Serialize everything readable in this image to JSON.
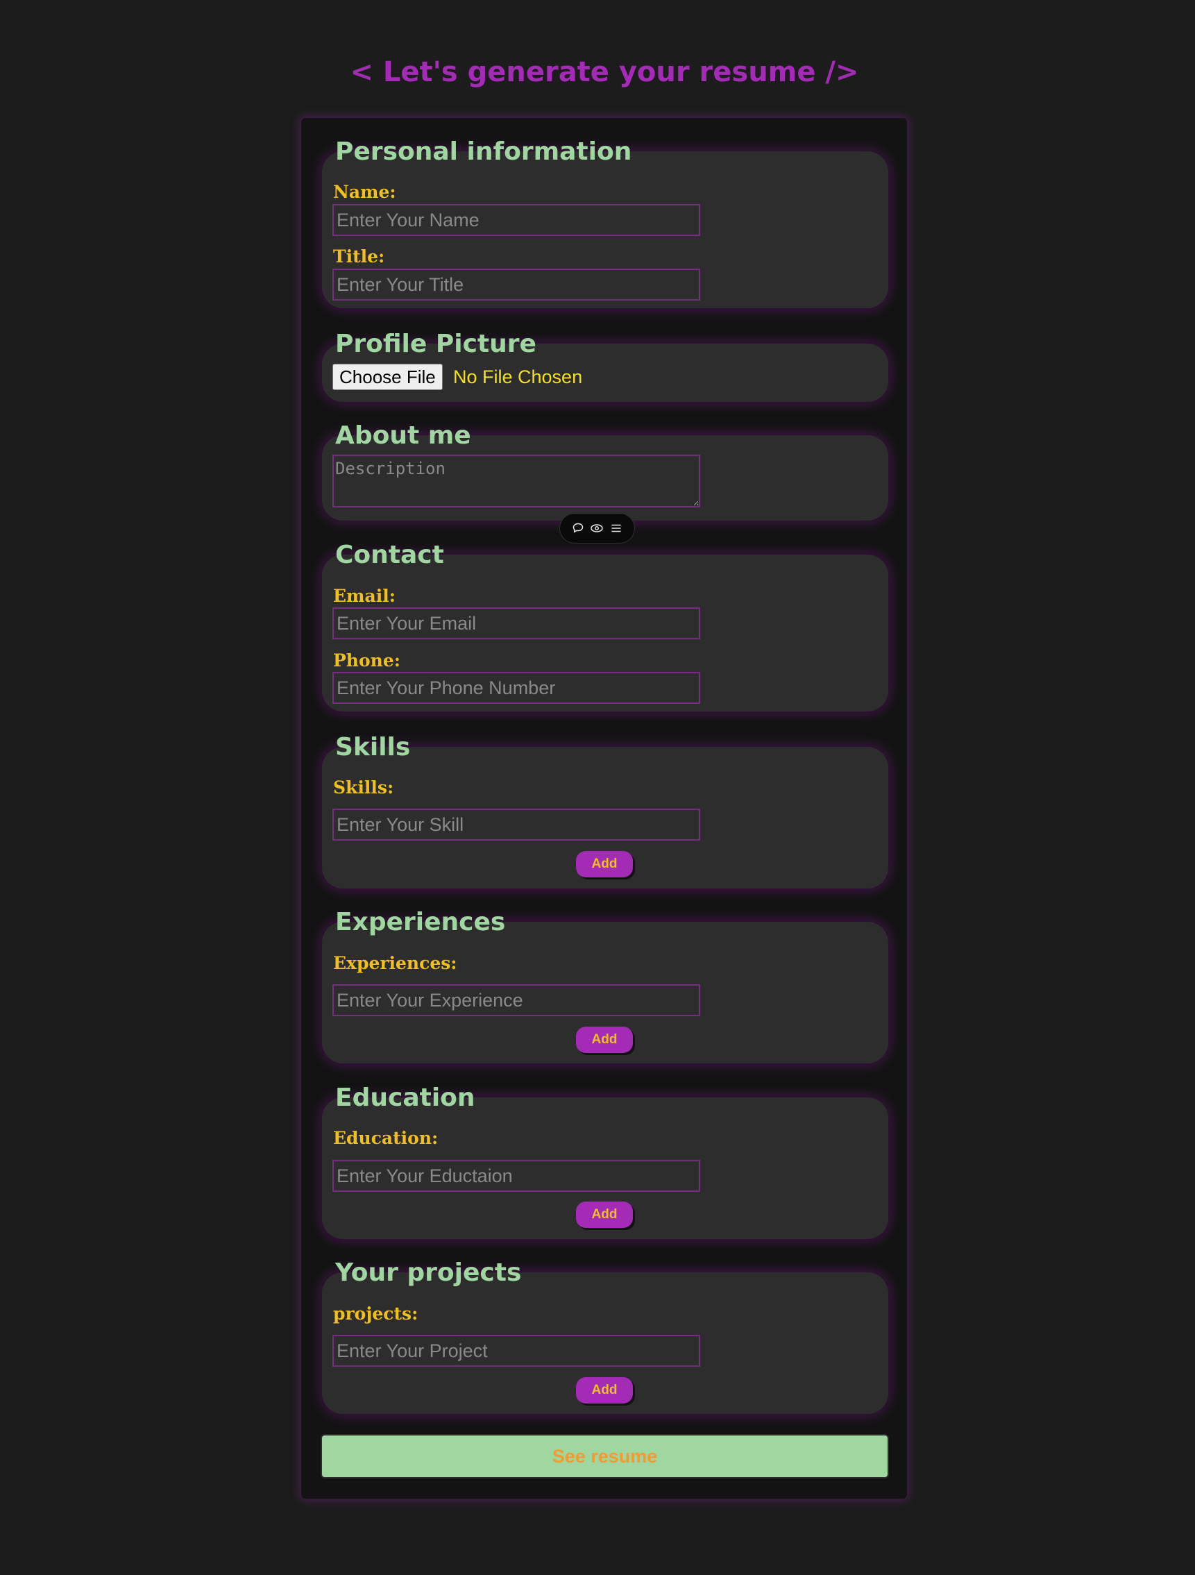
{
  "page": {
    "title": "< Let's generate your resume />"
  },
  "colors": {
    "background": "#1c1c1c",
    "accent_purple": "#a32bb5",
    "section_title_green": "#a0d7a0",
    "label_yellow": "#f0c020",
    "file_status_yellow": "#f5e020",
    "submit_text_orange": "#f39a30"
  },
  "personal": {
    "title": "Personal information",
    "name_label": "Name:",
    "name_placeholder": "Enter Your Name",
    "name_value": "",
    "title_label": "Title:",
    "title_placeholder": "Enter Your Title",
    "title_value": ""
  },
  "profile_picture": {
    "title": "Profile Picture",
    "choose_file_label": "Choose File",
    "file_status": "No File Chosen"
  },
  "about": {
    "title": "About me",
    "description_placeholder": "Description",
    "description_value": ""
  },
  "toolbar": {
    "icons": [
      "comment-icon",
      "eye-icon",
      "menu-icon"
    ]
  },
  "contact": {
    "title": "Contact",
    "email_label": "Email:",
    "email_placeholder": "Enter Your Email",
    "email_value": "",
    "phone_label": "Phone:",
    "phone_placeholder": "Enter Your Phone Number",
    "phone_value": ""
  },
  "skills": {
    "title": "Skills",
    "label": "Skills:",
    "placeholder": "Enter Your Skill",
    "value": "",
    "add_label": "Add"
  },
  "experiences": {
    "title": "Experiences",
    "label": "Experiences:",
    "placeholder": "Enter Your Experience",
    "value": "",
    "add_label": "Add"
  },
  "education": {
    "title": "Education",
    "label": "Education:",
    "placeholder": "Enter Your Eductaion",
    "value": "",
    "add_label": "Add"
  },
  "projects": {
    "title": "Your projects",
    "label": "projects:",
    "placeholder": "Enter Your Project",
    "value": "",
    "add_label": "Add"
  },
  "submit": {
    "label": "See resume"
  }
}
